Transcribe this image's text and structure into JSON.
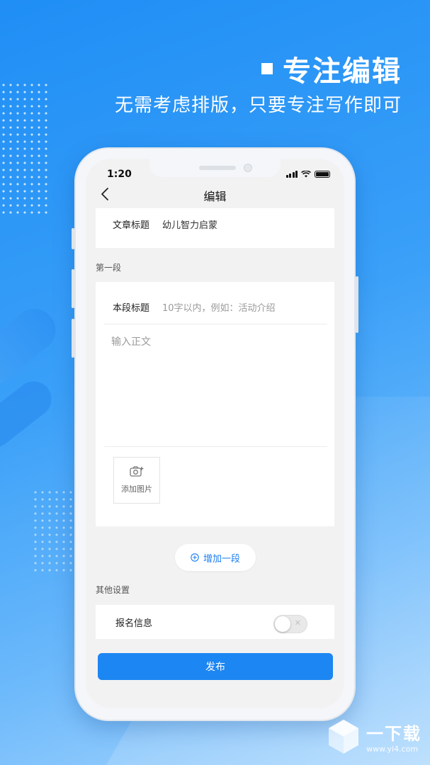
{
  "promo": {
    "title": "专注编辑",
    "subtitle": "无需考虑排版，只要专注写作即可"
  },
  "status_bar": {
    "time": "1:20"
  },
  "nav": {
    "title": "编辑"
  },
  "article": {
    "title_label": "文章标题",
    "title_value": "幼儿智力启蒙"
  },
  "segment": {
    "header": "第一段",
    "title_label": "本段标题",
    "title_placeholder": "10字以内，例如：活动介绍",
    "body_placeholder": "输入正文",
    "add_photo_label": "添加图片"
  },
  "add_segment_label": "增加一段",
  "other_settings": {
    "header": "其他设置",
    "signup_label": "报名信息",
    "signup_enabled": false
  },
  "publish_label": "发布",
  "watermark": {
    "name": "一下载",
    "url": "www.yi4.com"
  },
  "colors": {
    "accent": "#1c86f2",
    "background_top": "#1f8ef5",
    "background_bottom": "#a9d6fd"
  }
}
